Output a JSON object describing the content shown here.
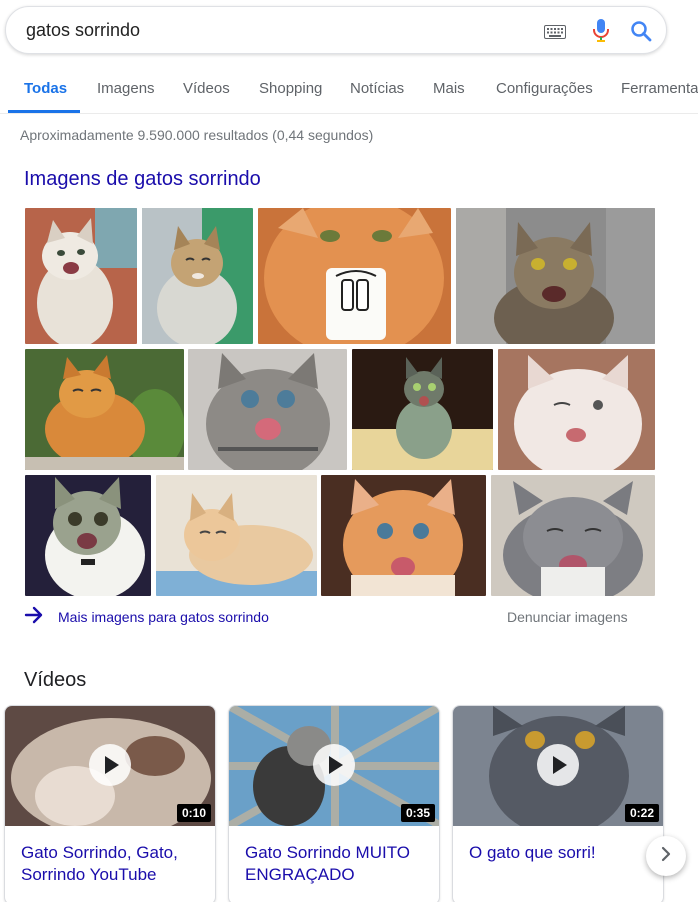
{
  "search": {
    "query": "gatos sorrindo"
  },
  "tabs": [
    {
      "label": "Todas"
    },
    {
      "label": "Imagens"
    },
    {
      "label": "Vídeos"
    },
    {
      "label": "Shopping"
    },
    {
      "label": "Notícias"
    },
    {
      "label": "Mais"
    },
    {
      "label": "Configurações"
    },
    {
      "label": "Ferramentas"
    }
  ],
  "stats": "Aproximadamente 9.590.000 resultados (0,44 segundos)",
  "images_section": {
    "heading": "Imagens de gatos sorrindo",
    "more_link": "Mais imagens para gatos sorrindo",
    "report_link": "Denunciar imagens"
  },
  "videos_section": {
    "heading": "Vídeos",
    "items": [
      {
        "title": "Gato Sorrindo, Gato, Sorrindo YouTube",
        "duration": "0:10"
      },
      {
        "title": "Gato Sorrindo MUITO ENGRAÇADO",
        "duration": "0:35"
      },
      {
        "title": "O gato que sorri!",
        "duration": "0:22"
      }
    ]
  },
  "colors": {
    "accent": "#1a73e8",
    "link": "#1a0dab",
    "muted": "#70757a"
  }
}
